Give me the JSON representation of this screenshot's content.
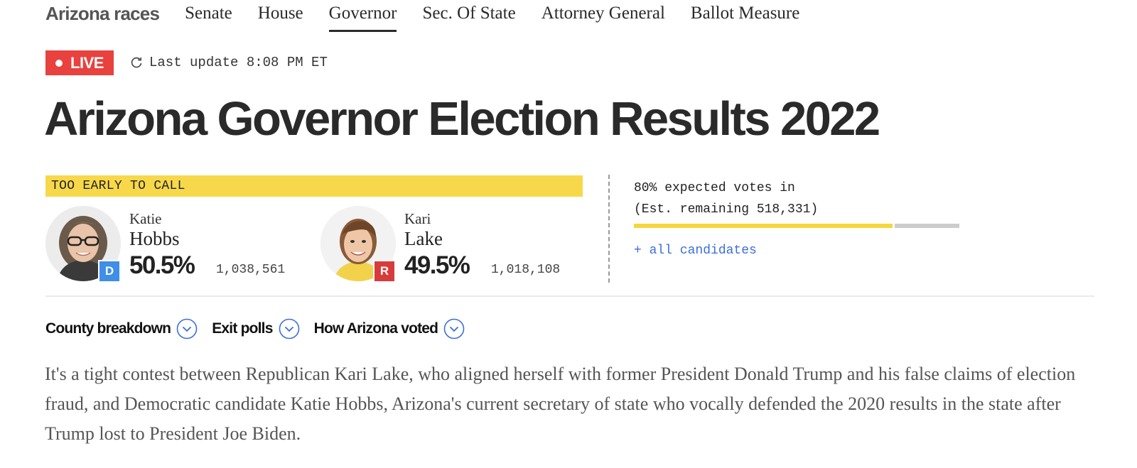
{
  "nav": {
    "title": "Arizona races",
    "items": [
      {
        "label": "Senate",
        "active": false
      },
      {
        "label": "House",
        "active": false
      },
      {
        "label": "Governor",
        "active": true
      },
      {
        "label": "Sec. Of State",
        "active": false
      },
      {
        "label": "Attorney General",
        "active": false
      },
      {
        "label": "Ballot Measure",
        "active": false
      }
    ]
  },
  "status": {
    "live_label": "LIVE",
    "refresh_icon": "refresh-icon",
    "last_update": "Last update 8:08 PM ET"
  },
  "headline": "Arizona Governor Election Results 2022",
  "race": {
    "call_status": "TOO EARLY TO CALL",
    "candidates": [
      {
        "first": "Katie",
        "last": "Hobbs",
        "party": "D",
        "party_color": "#3f8ee8",
        "pct": "50.5%",
        "votes": "1,038,561"
      },
      {
        "first": "Kari",
        "last": "Lake",
        "party": "R",
        "party_color": "#d83b3b",
        "pct": "49.5%",
        "votes": "1,018,108"
      }
    ],
    "expected_line1": "80% expected votes in",
    "expected_line2": "(Est. remaining 518,331)",
    "expected_fraction": 0.8,
    "all_candidates_label": "+ all candidates"
  },
  "tabs": [
    {
      "label": "County breakdown",
      "icon": "chevron-down-icon"
    },
    {
      "label": "Exit polls",
      "icon": "chevron-down-icon"
    },
    {
      "label": "How Arizona voted",
      "icon": "chevron-down-icon"
    }
  ],
  "paragraph": "It's a tight contest between Republican Kari Lake, who aligned herself with former President Donald Trump and his false claims of election fraud, and Democratic candidate Katie Hobbs, Arizona's current secretary of state who vocally defended the 2020 results in the state after Trump lost to President Joe Biden.",
  "colors": {
    "live_red": "#e8413e",
    "call_yellow": "#f7d84a",
    "link_blue": "#3b6fd8",
    "democrat_blue": "#3f8ee8",
    "republican_red": "#d83b3b"
  }
}
